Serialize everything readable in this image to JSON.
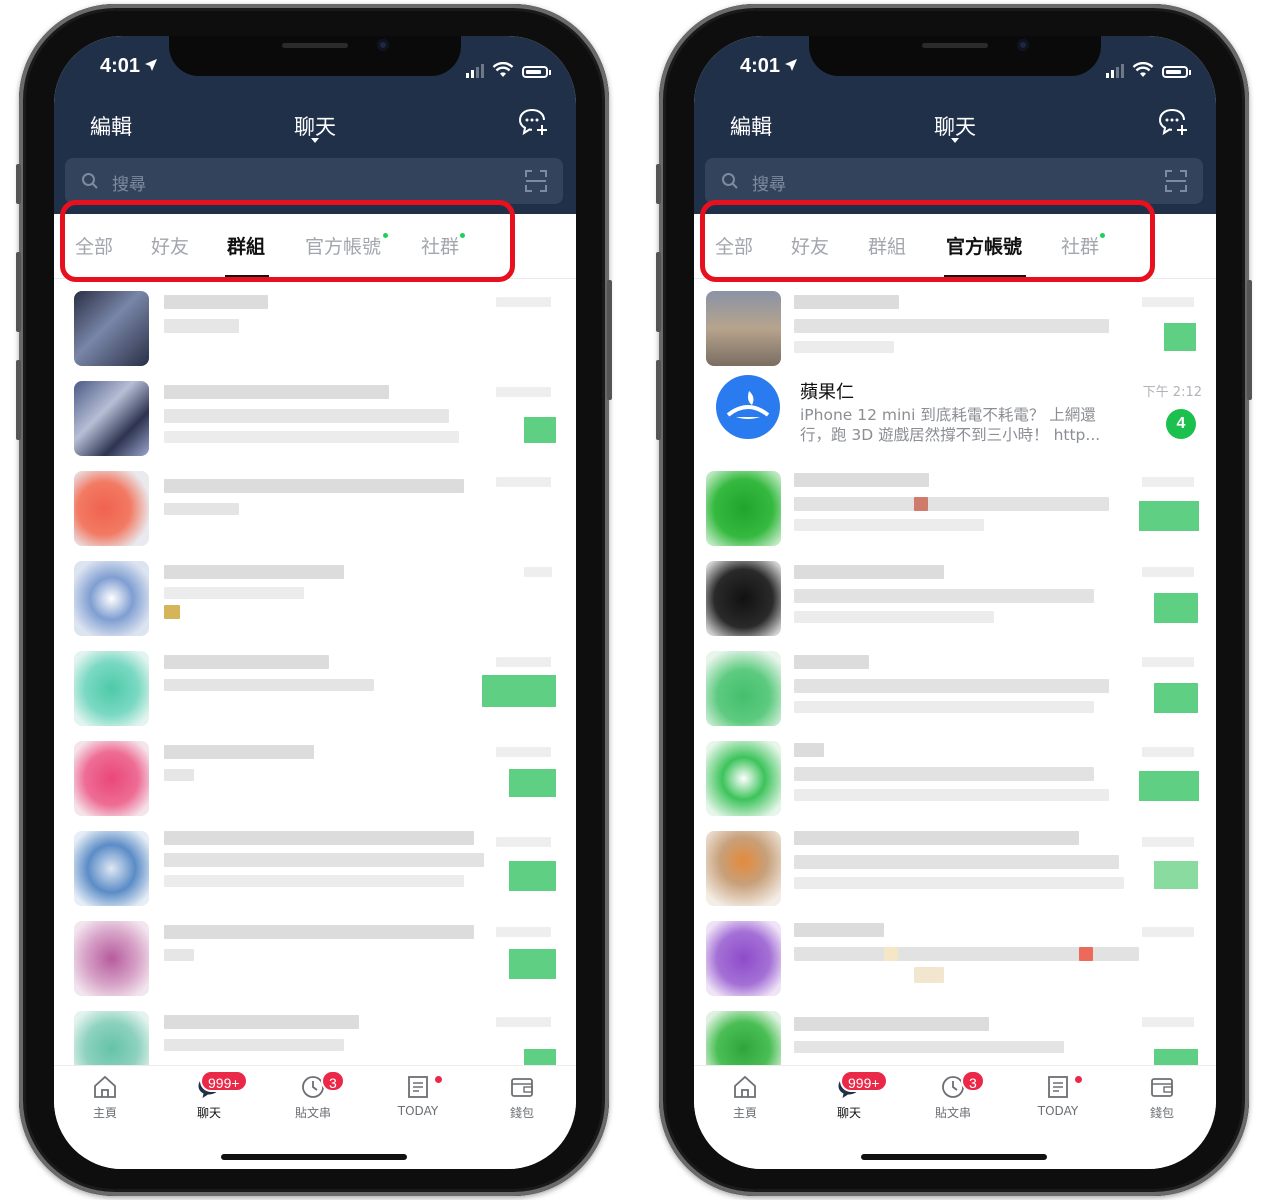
{
  "screens": [
    {
      "status_time": "4:01",
      "header": {
        "edit_label": "編輯",
        "title": "聊天"
      },
      "search": {
        "placeholder": "搜尋"
      },
      "tabs": [
        {
          "label": "全部"
        },
        {
          "label": "好友"
        },
        {
          "label": "群組"
        },
        {
          "label": "官方帳號"
        },
        {
          "label": "社群"
        }
      ],
      "active_tab": "群組",
      "tabbar": [
        {
          "label": "主頁"
        },
        {
          "label": "聊天",
          "badge": "999+"
        },
        {
          "label": "貼文串",
          "badge": "3"
        },
        {
          "label": "TODAY"
        },
        {
          "label": "錢包"
        }
      ]
    },
    {
      "status_time": "4:01",
      "header": {
        "edit_label": "編輯",
        "title": "聊天"
      },
      "search": {
        "placeholder": "搜尋"
      },
      "tabs": [
        {
          "label": "全部"
        },
        {
          "label": "好友"
        },
        {
          "label": "群組"
        },
        {
          "label": "官方帳號"
        },
        {
          "label": "社群"
        }
      ],
      "active_tab": "官方帳號",
      "official_chat": {
        "name": "蘋果仁",
        "message": "iPhone 12 mini 到底耗電不耗電？ 上網還行，跑 3D 遊戲居然撐不到三小時！ http...",
        "time": "下午 2:12",
        "unread": "4"
      },
      "tabbar": [
        {
          "label": "主頁"
        },
        {
          "label": "聊天",
          "badge": "999+"
        },
        {
          "label": "貼文串",
          "badge": "3"
        },
        {
          "label": "TODAY"
        },
        {
          "label": "錢包"
        }
      ]
    }
  ],
  "colors": {
    "header_bg": "#213049",
    "search_bg": "#34435c",
    "highlight_border": "#e8101e",
    "badge_red": "#ea2847",
    "unread_green": "#1cc04f",
    "online_dot": "#1fcf5c"
  },
  "icons": [
    "compose-chat-icon",
    "search-icon",
    "scan-icon",
    "home-icon",
    "chat-icon",
    "timeline-clock-icon",
    "today-news-icon",
    "wallet-icon"
  ]
}
